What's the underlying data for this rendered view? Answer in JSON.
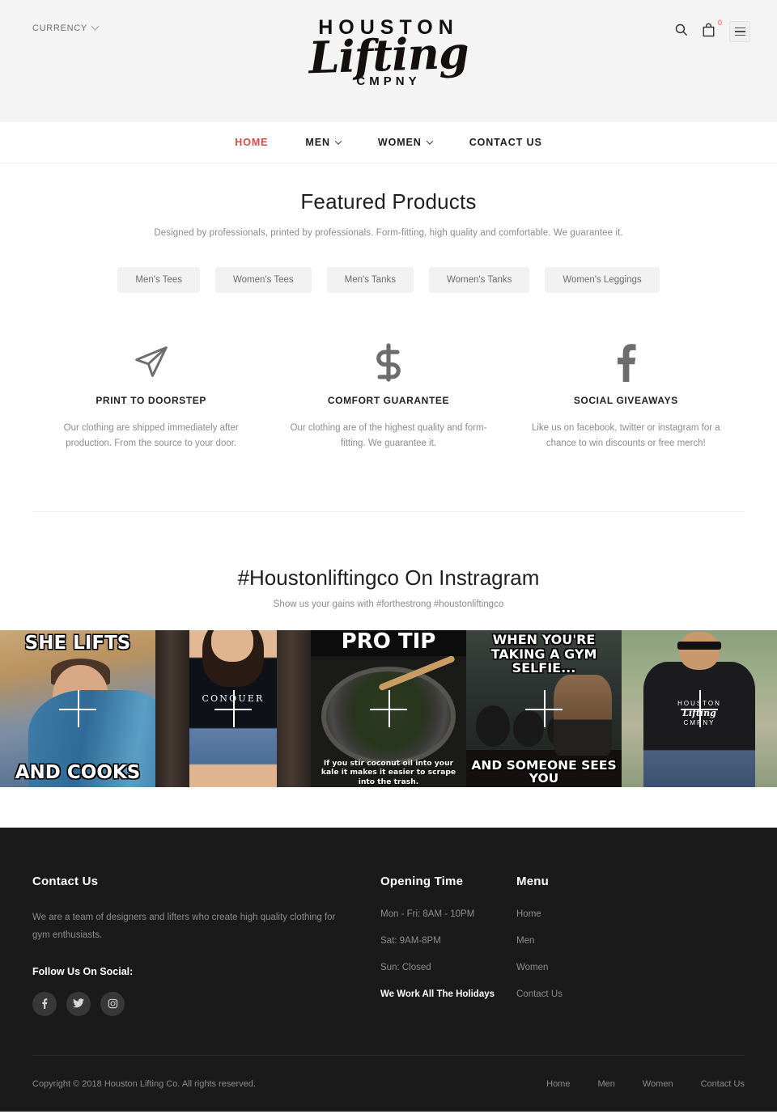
{
  "header": {
    "currency_label": "CURRENCY",
    "logo": {
      "top": "HOUSTON",
      "script": "Lifting",
      "bottom": "CMPNY"
    },
    "cart_count": "0",
    "icons": {
      "search": "search-icon",
      "cart": "cart-icon",
      "menu": "hamburger-icon"
    }
  },
  "nav": [
    {
      "label": "HOME",
      "active": true,
      "caret": false
    },
    {
      "label": "MEN",
      "active": false,
      "caret": true
    },
    {
      "label": "WOMEN",
      "active": false,
      "caret": true
    },
    {
      "label": "CONTACT US",
      "active": false,
      "caret": false
    }
  ],
  "featured": {
    "title": "Featured Products",
    "subtitle": "Designed by professionals, printed by professionals. Form-fitting, high quality and comfortable. We guarantee it.",
    "categories": [
      "Men's Tees",
      "Women's Tees",
      "Men's Tanks",
      "Women's Tanks",
      "Women's Leggings"
    ]
  },
  "features": [
    {
      "icon": "paper-plane-icon",
      "title": "PRINT TO DOORSTEP",
      "desc": "Our clothing are shipped immediately after production. From the source to your door."
    },
    {
      "icon": "dollar-sign-icon",
      "title": "COMFORT GUARANTEE",
      "desc": "Our clothing are of the highest quality and form-fitting. We guarantee it."
    },
    {
      "icon": "facebook-icon",
      "title": "SOCIAL GIVEAWAYS",
      "desc": "Like us on facebook, twitter or instagram for a chance to win discounts or free merch!"
    }
  ],
  "instagram": {
    "title": "#Houstonliftingco On Instragram",
    "subtitle": "Show us your gains with #forthestrong #houstonliftingco",
    "posts": [
      {
        "caption_top": "SHE LIFTS",
        "caption_bottom": "AND COOKS",
        "alt": "wolf-of-wall-street-meme"
      },
      {
        "caption_top": "",
        "caption_bottom": "",
        "tee_text": "CONQUER",
        "alt": "conquer-womens-tee"
      },
      {
        "caption_top": "PRO TIP",
        "caption_bottom": "If you stir coconut oil into your kale it makes it easier to scrape into the trash.",
        "alt": "kale-pro-tip-meme"
      },
      {
        "caption_top": "WHEN YOU'RE TAKING A GYM SELFIE...",
        "caption_bottom": "AND SOMEONE SEES YOU",
        "alt": "gym-selfie-meme"
      },
      {
        "caption_top": "",
        "caption_bottom": "",
        "tee_brand_top": "HOUSTON",
        "tee_brand_script": "Lifting",
        "tee_brand_bottom": "CMPNY",
        "alt": "houston-lifting-mens-tee"
      }
    ]
  },
  "footer": {
    "contact": {
      "title": "Contact Us",
      "text": "We are a team of designers and lifters who create high quality clothing for gym enthusiasts.",
      "follow_label": "Follow Us On Social:",
      "socials": [
        "facebook-icon",
        "twitter-icon",
        "instagram-icon"
      ]
    },
    "opening": {
      "title": "Opening Time",
      "rows": [
        "Mon - Fri: 8AM - 10PM",
        "Sat: 9AM-8PM",
        "Sun: Closed"
      ],
      "note": "We Work All The Holidays"
    },
    "menu": {
      "title": "Menu",
      "items": [
        "Home",
        "Men",
        "Women",
        "Contact Us"
      ]
    },
    "copyright": "Copyright © 2018 Houston Lifting Co. All rights reserved.",
    "bottom_nav": [
      "Home",
      "Men",
      "Women",
      "Contact Us"
    ]
  },
  "colors": {
    "accent_red": "#d94c43",
    "badge_red": "#e8473f",
    "header_bg": "#f4f4f4",
    "footer_bg": "#1a1a1a",
    "muted_text": "#8d8d8d"
  }
}
